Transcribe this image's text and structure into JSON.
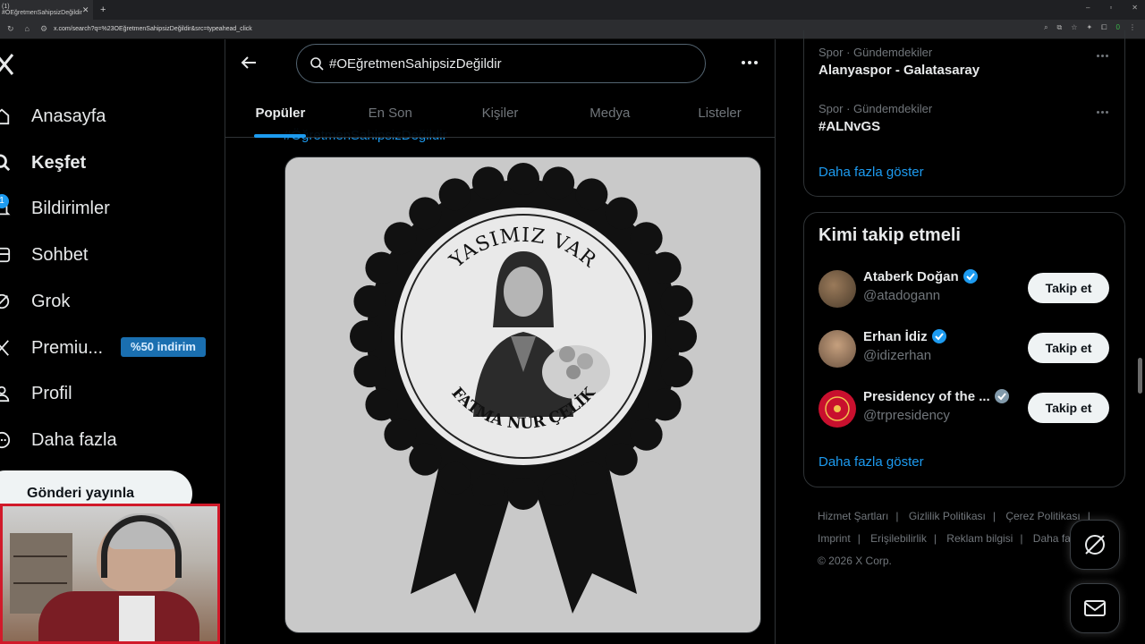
{
  "browser": {
    "tab_title": "(1) #OEğretmenSahipsizDeğildir",
    "url": "x.com/search?q=%23OEğretmenSahipsizDeğildir&src=typeahead_click",
    "ext_badge": "0"
  },
  "nav": {
    "notif_count": "1",
    "items": [
      {
        "label": "Anasayfa",
        "icon": "home-icon"
      },
      {
        "label": "Keşfet",
        "icon": "search-icon"
      },
      {
        "label": "Bildirimler",
        "icon": "bell-icon"
      },
      {
        "label": "Sohbet",
        "icon": "chat-icon"
      },
      {
        "label": "Grok",
        "icon": "grok-icon"
      },
      {
        "label": "Premiu...",
        "icon": "x-logo-icon"
      },
      {
        "label": "Profil",
        "icon": "profile-icon"
      },
      {
        "label": "Daha fazla",
        "icon": "more-circle-icon"
      }
    ],
    "premium_badge": "%50 indirim",
    "post_button": "Gönderi yayınla"
  },
  "search": {
    "query": "#OEğretmenSahipsizDeğildir",
    "tabs": [
      "Popüler",
      "En Son",
      "Kişiler",
      "Medya",
      "Listeler"
    ],
    "active_tab": "Popüler"
  },
  "post": {
    "hashtag": "#ÖğretmenSahipsizDeğildir",
    "badge_top": "YASIMIZ VAR",
    "badge_bottom": "FATMA NUR ÇELİK"
  },
  "trends": {
    "items": [
      {
        "meta": "Spor · Gündemdekiler",
        "name": "Alanyaspor - Galatasaray"
      },
      {
        "meta": "Spor · Gündemdekiler",
        "name": "#ALNvGS"
      }
    ],
    "show_more": "Daha fazla göster"
  },
  "who_to_follow": {
    "title": "Kimi takip etmeli",
    "users": [
      {
        "name": "Ataberk Doğan",
        "handle": "@atadogann",
        "badge": "blue"
      },
      {
        "name": "Erhan İdiz",
        "handle": "@idizerhan",
        "badge": "blue"
      },
      {
        "name": "Presidency of the ...",
        "handle": "@trpresidency",
        "badge": "grey"
      }
    ],
    "follow_label": "Takip et",
    "show_more": "Daha fazla göster"
  },
  "footer": {
    "links": [
      "Hizmet Şartları",
      "Gizlilik Politikası",
      "Çerez Politikası",
      "Imprint",
      "Erişilebilirlik",
      "Reklam bilgisi",
      "Daha fa"
    ],
    "copyright": "© 2026 X Corp."
  },
  "colors": {
    "accent": "#1d9bf0",
    "background": "#000000",
    "border": "#2f3336"
  }
}
